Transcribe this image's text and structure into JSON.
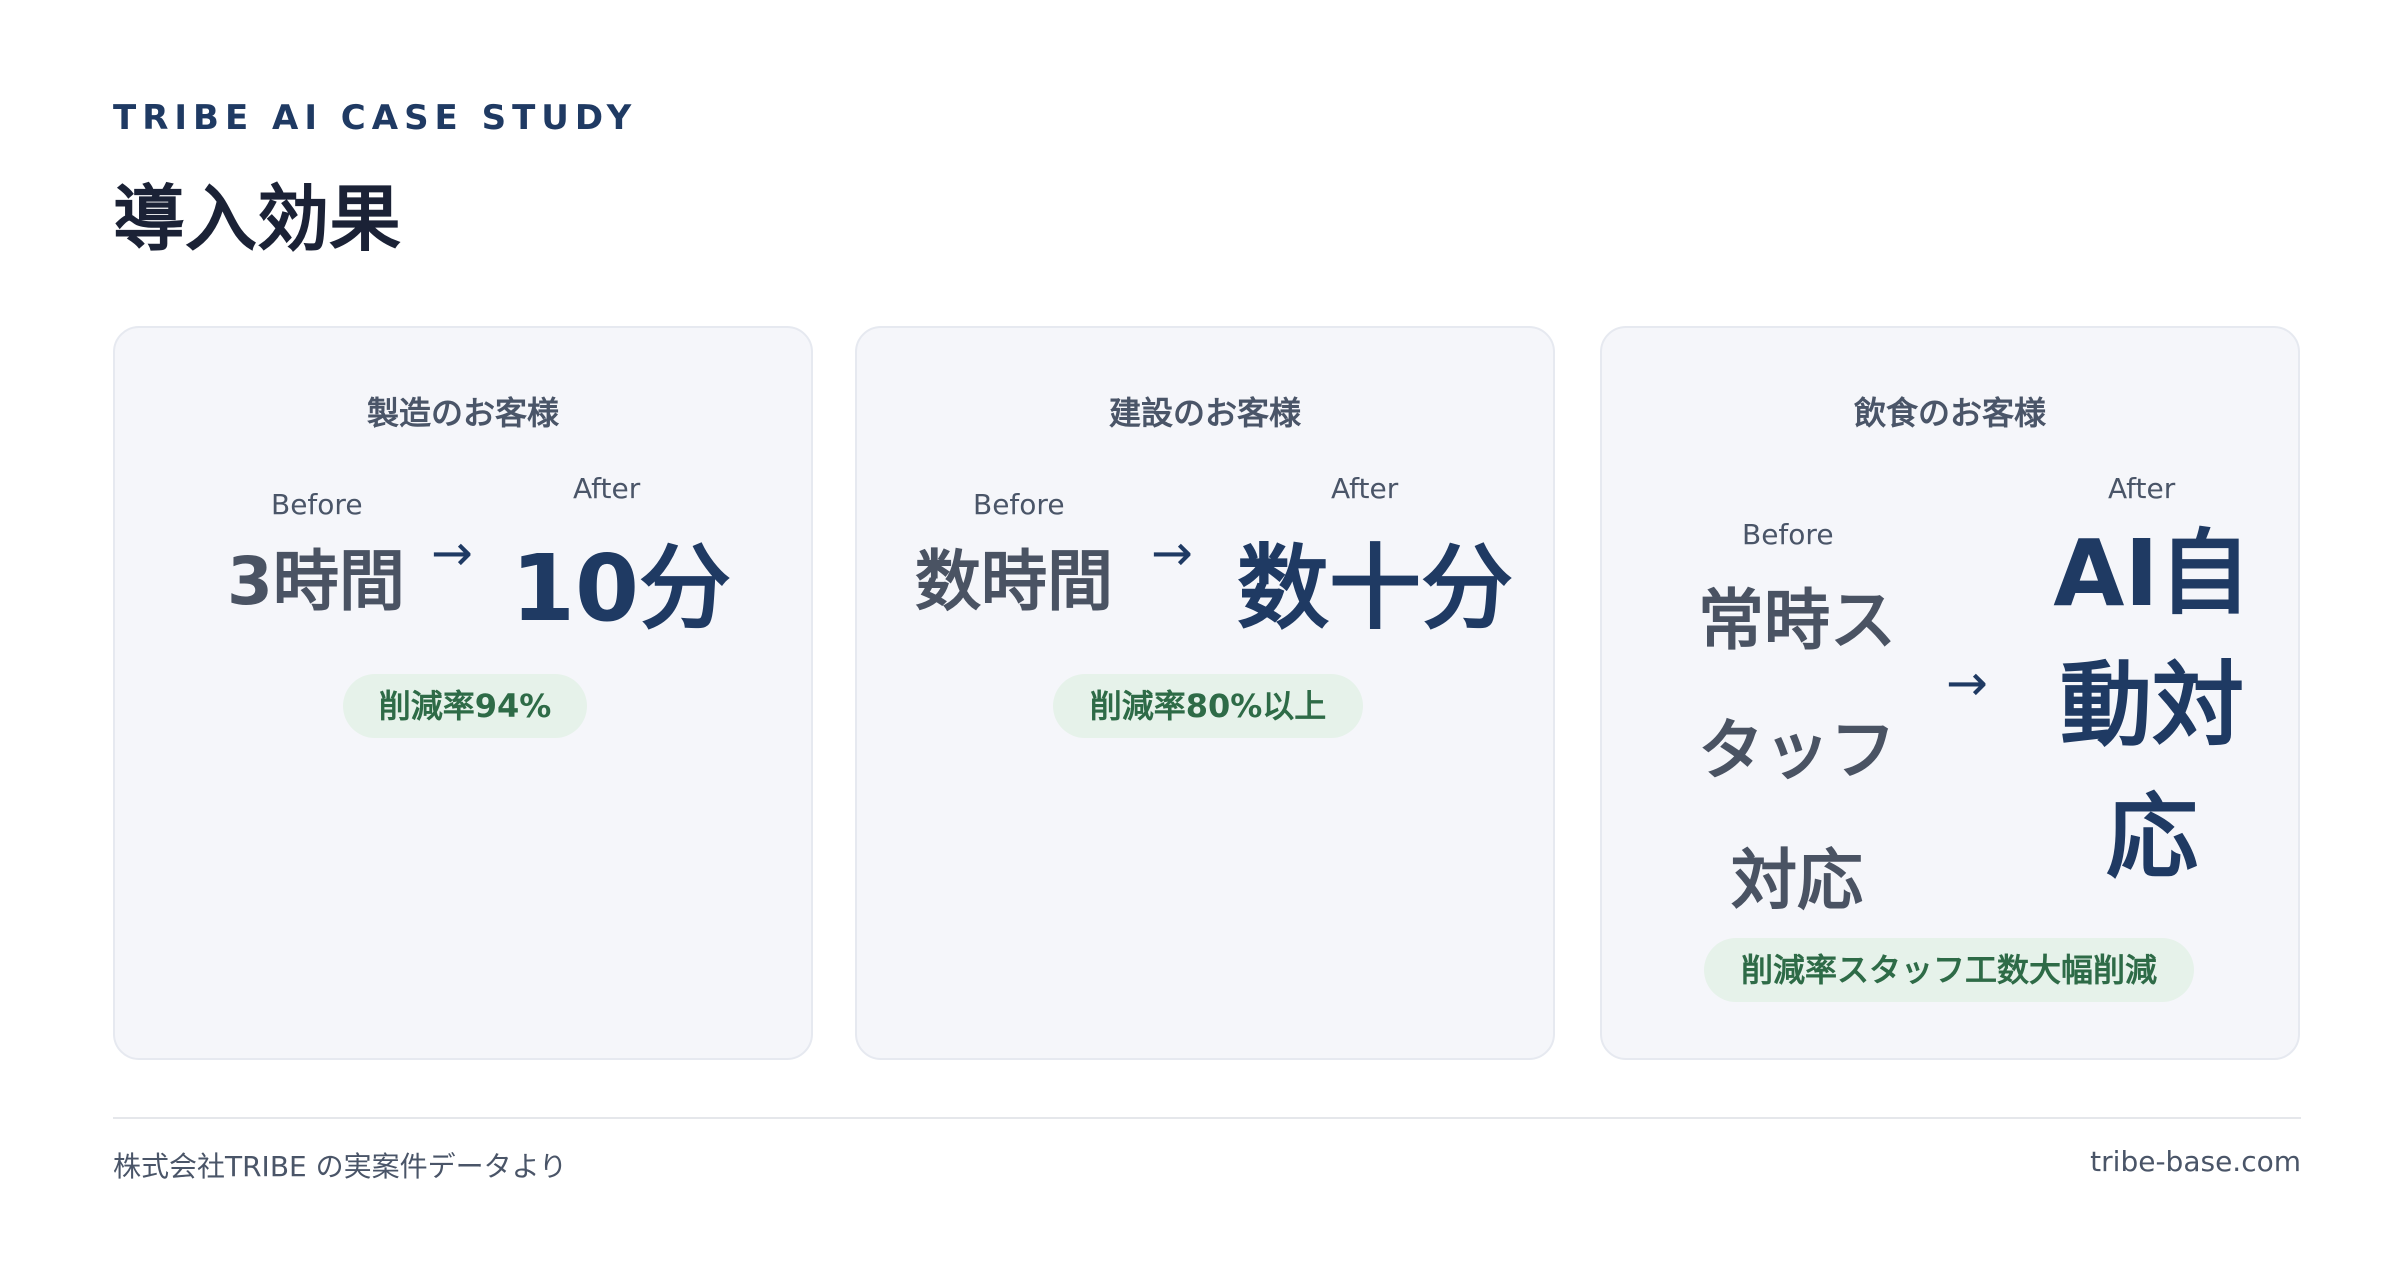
{
  "header": {
    "eyebrow": "TRIBE AI CASE STUDY",
    "title": "導入効果"
  },
  "cards": [
    {
      "title": "製造のお客様",
      "before_label": "Before",
      "before_value": "3時間",
      "arrow": "→",
      "after_label": "After",
      "after_value": "10分",
      "badge": "削減率94%"
    },
    {
      "title": "建設のお客様",
      "before_label": "Before",
      "before_value": "数時間",
      "arrow": "→",
      "after_label": "After",
      "after_value": "数十分",
      "badge": "削減率80%以上"
    },
    {
      "title": "飲食のお客様",
      "before_label": "Before",
      "before_lines": [
        "常時ス",
        "タッフ",
        "対応"
      ],
      "arrow": "→",
      "after_label": "After",
      "after_lines": [
        "AI自",
        "動対",
        "応"
      ],
      "badge": "削減率スタッフ工数大幅削減"
    }
  ],
  "footer": {
    "source": "株式会社TRIBE の実案件データより",
    "site": "tribe-base.com"
  }
}
